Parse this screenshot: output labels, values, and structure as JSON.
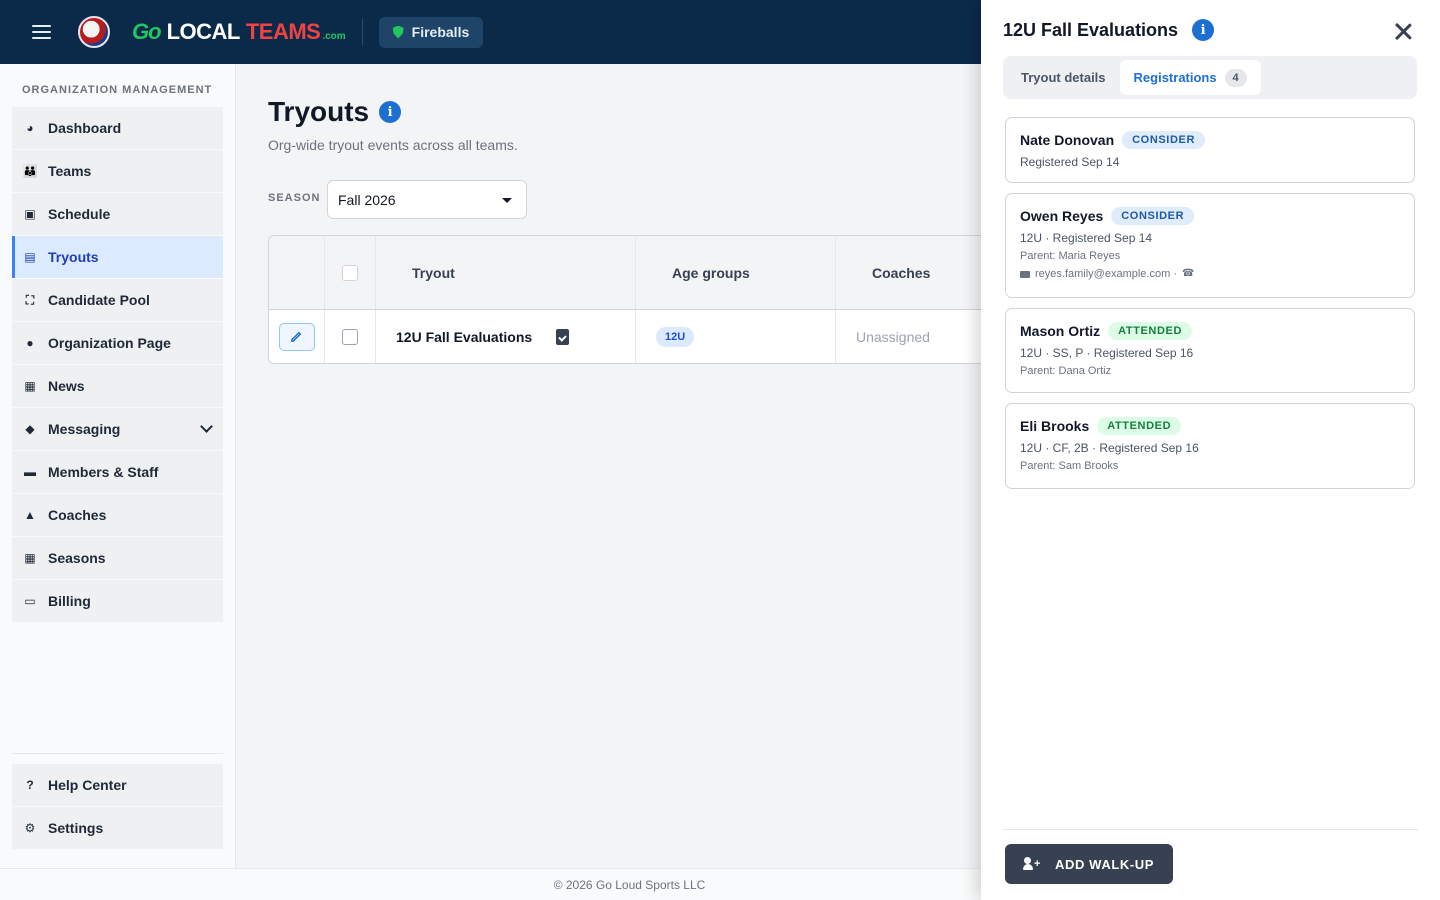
{
  "header": {
    "logo": {
      "go": "Go",
      "local": "LOCAL",
      "teams": "TEAMS",
      "com": ".com"
    },
    "team_name": "Fireballs",
    "menu_icon": "hamburger-icon"
  },
  "sidebar": {
    "heading": "ORGANIZATION MANAGEMENT",
    "items": [
      {
        "label": "Dashboard",
        "icon": "dashboard-icon"
      },
      {
        "label": "Teams",
        "icon": "teams-icon"
      },
      {
        "label": "Schedule",
        "icon": "calendar-icon"
      },
      {
        "label": "Tryouts",
        "icon": "clipboard-icon",
        "active": true
      },
      {
        "label": "Candidate Pool",
        "icon": "candidate-pool-icon"
      },
      {
        "label": "Organization Page",
        "icon": "globe-icon"
      },
      {
        "label": "News",
        "icon": "newspaper-icon"
      },
      {
        "label": "Messaging",
        "icon": "chat-icon",
        "expandable": true
      },
      {
        "label": "Members & Staff",
        "icon": "id-card-icon"
      },
      {
        "label": "Coaches",
        "icon": "user-icon"
      },
      {
        "label": "Seasons",
        "icon": "calendar-grid-icon"
      },
      {
        "label": "Billing",
        "icon": "credit-card-icon"
      }
    ],
    "bottom_items": [
      {
        "label": "Help Center",
        "icon": "help-icon"
      },
      {
        "label": "Settings",
        "icon": "gear-icon"
      }
    ]
  },
  "main": {
    "title": "Tryouts",
    "subtitle": "Org-wide tryout events across all teams.",
    "season_label": "SEASON",
    "season_value": "Fall 2026",
    "table": {
      "columns": [
        "Tryout",
        "Age groups",
        "Coaches"
      ],
      "rows": [
        {
          "tryout": "12U Fall Evaluations",
          "age_group": "12U",
          "coaches": "Unassigned"
        }
      ]
    }
  },
  "footer": {
    "text": "© 2026 Go Loud Sports LLC"
  },
  "drawer": {
    "title": "12U Fall Evaluations",
    "tabs": [
      {
        "label": "Tryout details",
        "active": false
      },
      {
        "label": "Registrations",
        "active": true,
        "count": "4"
      }
    ],
    "registrations": [
      {
        "name": "Nate Donovan",
        "status": "CONSIDER",
        "status_type": "consider",
        "line1": "Registered Sep 14",
        "parent": "",
        "contact": ""
      },
      {
        "name": "Owen Reyes",
        "status": "CONSIDER",
        "status_type": "consider",
        "line1": "12U · Registered Sep 14",
        "parent": "Parent: Maria Reyes",
        "contact": "reyes.family@example.com ·"
      },
      {
        "name": "Mason Ortiz",
        "status": "ATTENDED",
        "status_type": "attended",
        "line1": "12U · SS, P · Registered Sep 16",
        "parent": "Parent: Dana Ortiz",
        "contact": ""
      },
      {
        "name": "Eli Brooks",
        "status": "ATTENDED",
        "status_type": "attended",
        "line1": "12U · CF, 2B · Registered Sep 16",
        "parent": "Parent: Sam Brooks",
        "contact": ""
      }
    ],
    "walkup_label": "ADD WALK-UP"
  },
  "colors": {
    "topbar": "#0b2a4a",
    "accent": "#1d6fd1",
    "consider": "#1e5aa8",
    "attended": "#15803d"
  }
}
